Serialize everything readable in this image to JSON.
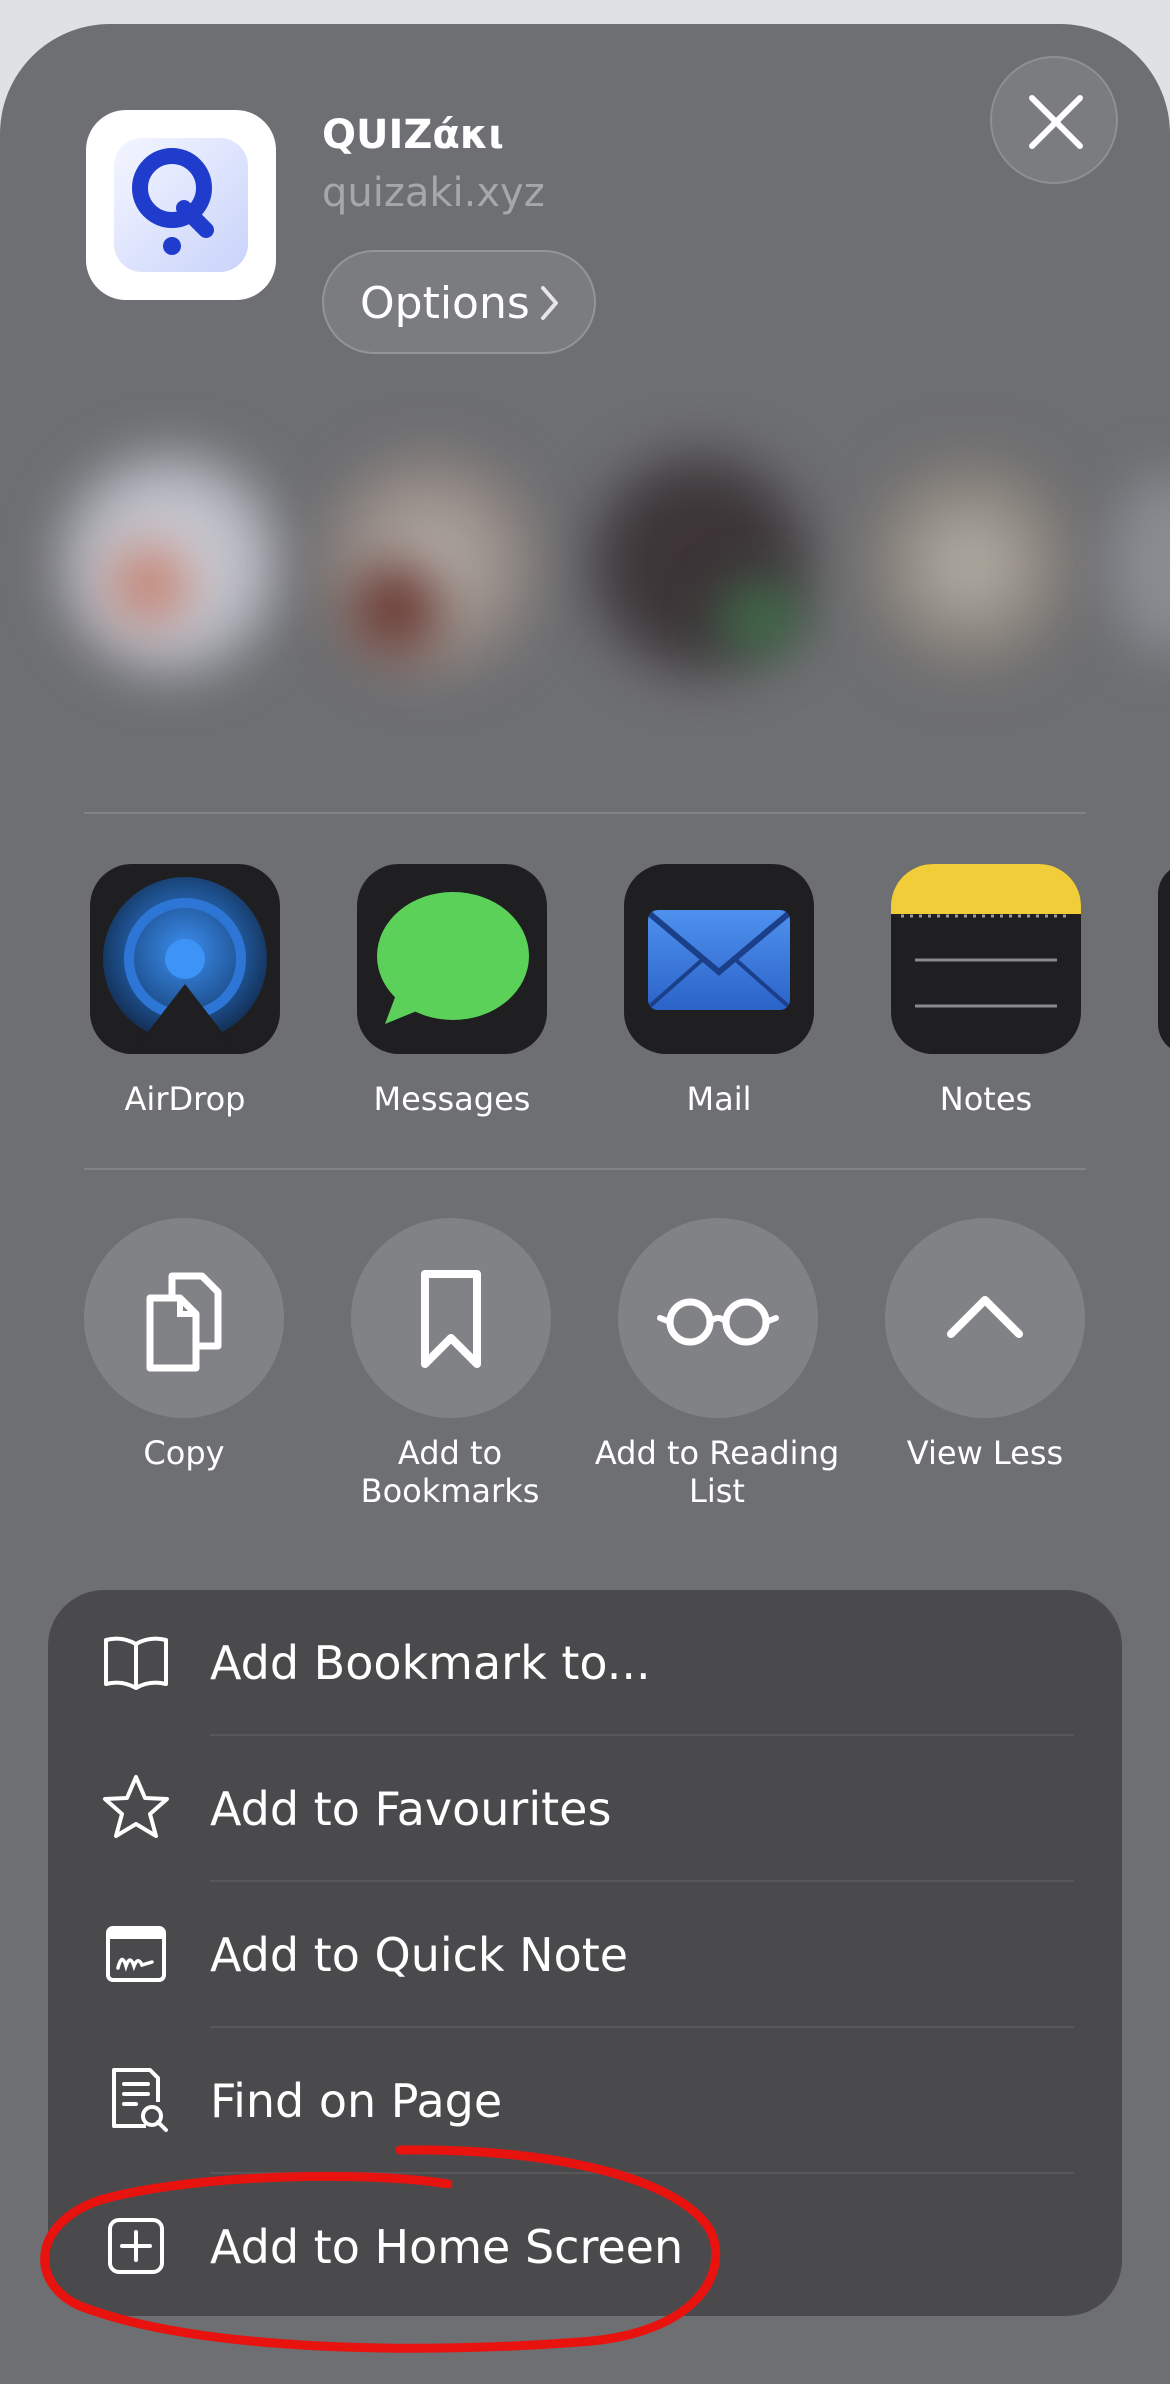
{
  "header": {
    "app_title": "QUIZάκι",
    "app_url": "quizaki.xyz",
    "options_label": "Options"
  },
  "apps": [
    {
      "label": "AirDrop",
      "icon": "airdrop-icon"
    },
    {
      "label": "Messages",
      "icon": "messages-icon"
    },
    {
      "label": "Mail",
      "icon": "mail-icon"
    },
    {
      "label": "Notes",
      "icon": "notes-icon"
    }
  ],
  "actions": [
    {
      "label": "Copy",
      "icon": "copy-icon"
    },
    {
      "label": "Add to Bookmarks",
      "icon": "bookmark-icon"
    },
    {
      "label": "Add to Reading List",
      "icon": "glasses-icon"
    },
    {
      "label": "View Less",
      "icon": "chevron-up-icon"
    }
  ],
  "menu": [
    {
      "label": "Add Bookmark to...",
      "icon": "book-icon"
    },
    {
      "label": "Add to Favourites",
      "icon": "star-icon"
    },
    {
      "label": "Add to Quick Note",
      "icon": "quick-note-icon"
    },
    {
      "label": "Find on Page",
      "icon": "find-on-page-icon"
    },
    {
      "label": "Add to Home Screen",
      "icon": "plus-square-icon"
    }
  ],
  "colors": {
    "sheet": "#6e6f72",
    "menu_background": "#4a4a4c",
    "annotation_circle": "#e8130f",
    "airdrop_blue": "#2c7ee6",
    "messages_green": "#5bd15a",
    "notes_yellow": "#f2cd3a"
  }
}
